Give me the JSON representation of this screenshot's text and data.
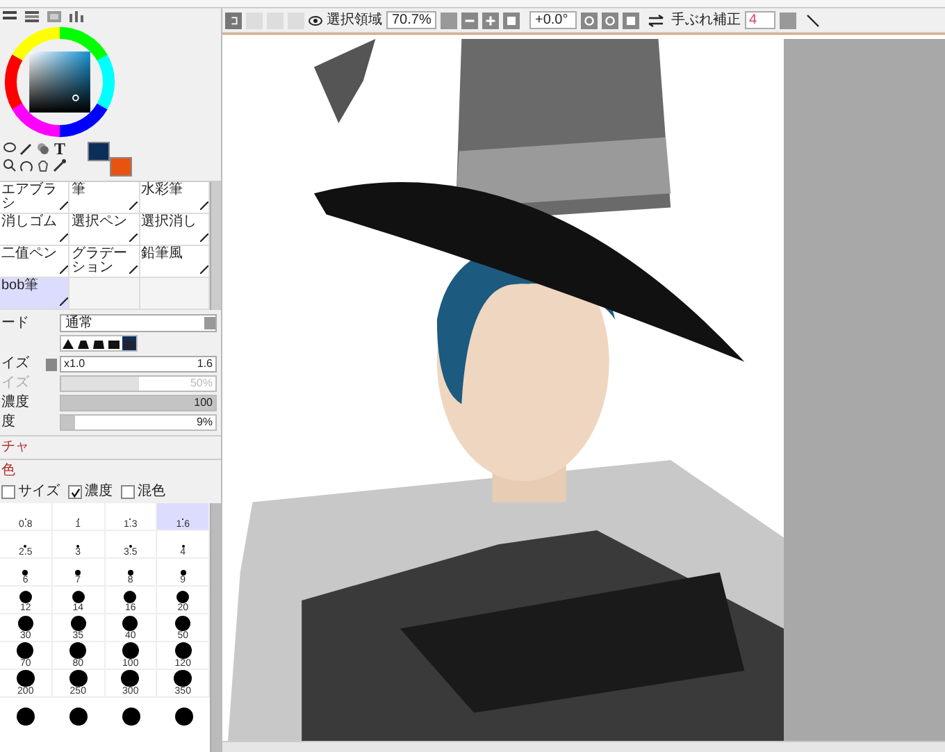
{
  "toolbar": {
    "selection_label": "選択領域",
    "zoom": "70.7%",
    "angle": "+0.0°",
    "stabilizer_label": "手ぶれ補正",
    "stabilizer": "4"
  },
  "text_tool": "T",
  "color_swatches": [
    {
      "color": "#0c2f5a"
    },
    {
      "color": "#e8540f"
    }
  ],
  "brushes": [
    {
      "label": "エアブラシ",
      "selected": false
    },
    {
      "label": "筆",
      "selected": false
    },
    {
      "label": "水彩筆",
      "selected": false
    },
    {
      "label": "消しゴム",
      "selected": false
    },
    {
      "label": "選択ペン",
      "selected": false
    },
    {
      "label": "選択消し",
      "selected": false
    },
    {
      "label": "二值ペン",
      "selected": false
    },
    {
      "label": "グラデーション",
      "selected": false
    },
    {
      "label": "鉛筆風",
      "selected": false
    },
    {
      "label": "bob筆",
      "selected": true
    }
  ],
  "mode": {
    "label": "ード",
    "value": "通常"
  },
  "tip_shapes": [
    {
      "selected": false
    },
    {
      "selected": false
    },
    {
      "selected": false
    },
    {
      "selected": false
    },
    {
      "selected": true
    }
  ],
  "params": [
    {
      "kind": "field",
      "label": "イズ",
      "value": "x1.0",
      "reading": "1.6",
      "disabled": false
    },
    {
      "kind": "bar",
      "label": "イズ",
      "reading": "50%",
      "level": 0.5,
      "disabled": true
    },
    {
      "kind": "bar",
      "label": "濃度",
      "reading": "100",
      "level": 1,
      "disabled": false
    },
    {
      "kind": "bar",
      "label": "度",
      "reading": "9%",
      "level": 0.09,
      "disabled": false
    }
  ],
  "sections": [
    {
      "label": "チャ"
    },
    {
      "label": "色"
    }
  ],
  "checks": [
    {
      "label": "サイズ",
      "checked": false
    },
    {
      "label": "濃度",
      "checked": true
    },
    {
      "label": "混色",
      "checked": false
    }
  ],
  "sizes": [
    {
      "label": "0.8",
      "selected": false
    },
    {
      "label": "1",
      "selected": false
    },
    {
      "label": "1.3",
      "selected": false
    },
    {
      "label": "1.6",
      "selected": true
    },
    {
      "label": "2.5",
      "selected": false
    },
    {
      "label": "3",
      "selected": false
    },
    {
      "label": "3.5",
      "selected": false
    },
    {
      "label": "4",
      "selected": false
    },
    {
      "label": "6",
      "selected": false
    },
    {
      "label": "7",
      "selected": false
    },
    {
      "label": "8",
      "selected": false
    },
    {
      "label": "9",
      "selected": false
    },
    {
      "label": "12",
      "selected": false
    },
    {
      "label": "14",
      "selected": false
    },
    {
      "label": "16",
      "selected": false
    },
    {
      "label": "20",
      "selected": false
    },
    {
      "label": "30",
      "selected": false
    },
    {
      "label": "35",
      "selected": false
    },
    {
      "label": "40",
      "selected": false
    },
    {
      "label": "50",
      "selected": false
    },
    {
      "label": "70",
      "selected": false
    },
    {
      "label": "80",
      "selected": false
    },
    {
      "label": "100",
      "selected": false
    },
    {
      "label": "120",
      "selected": false
    },
    {
      "label": "200",
      "selected": false
    },
    {
      "label": "250",
      "selected": false
    },
    {
      "label": "300",
      "selected": false
    },
    {
      "label": "350",
      "selected": false
    }
  ]
}
